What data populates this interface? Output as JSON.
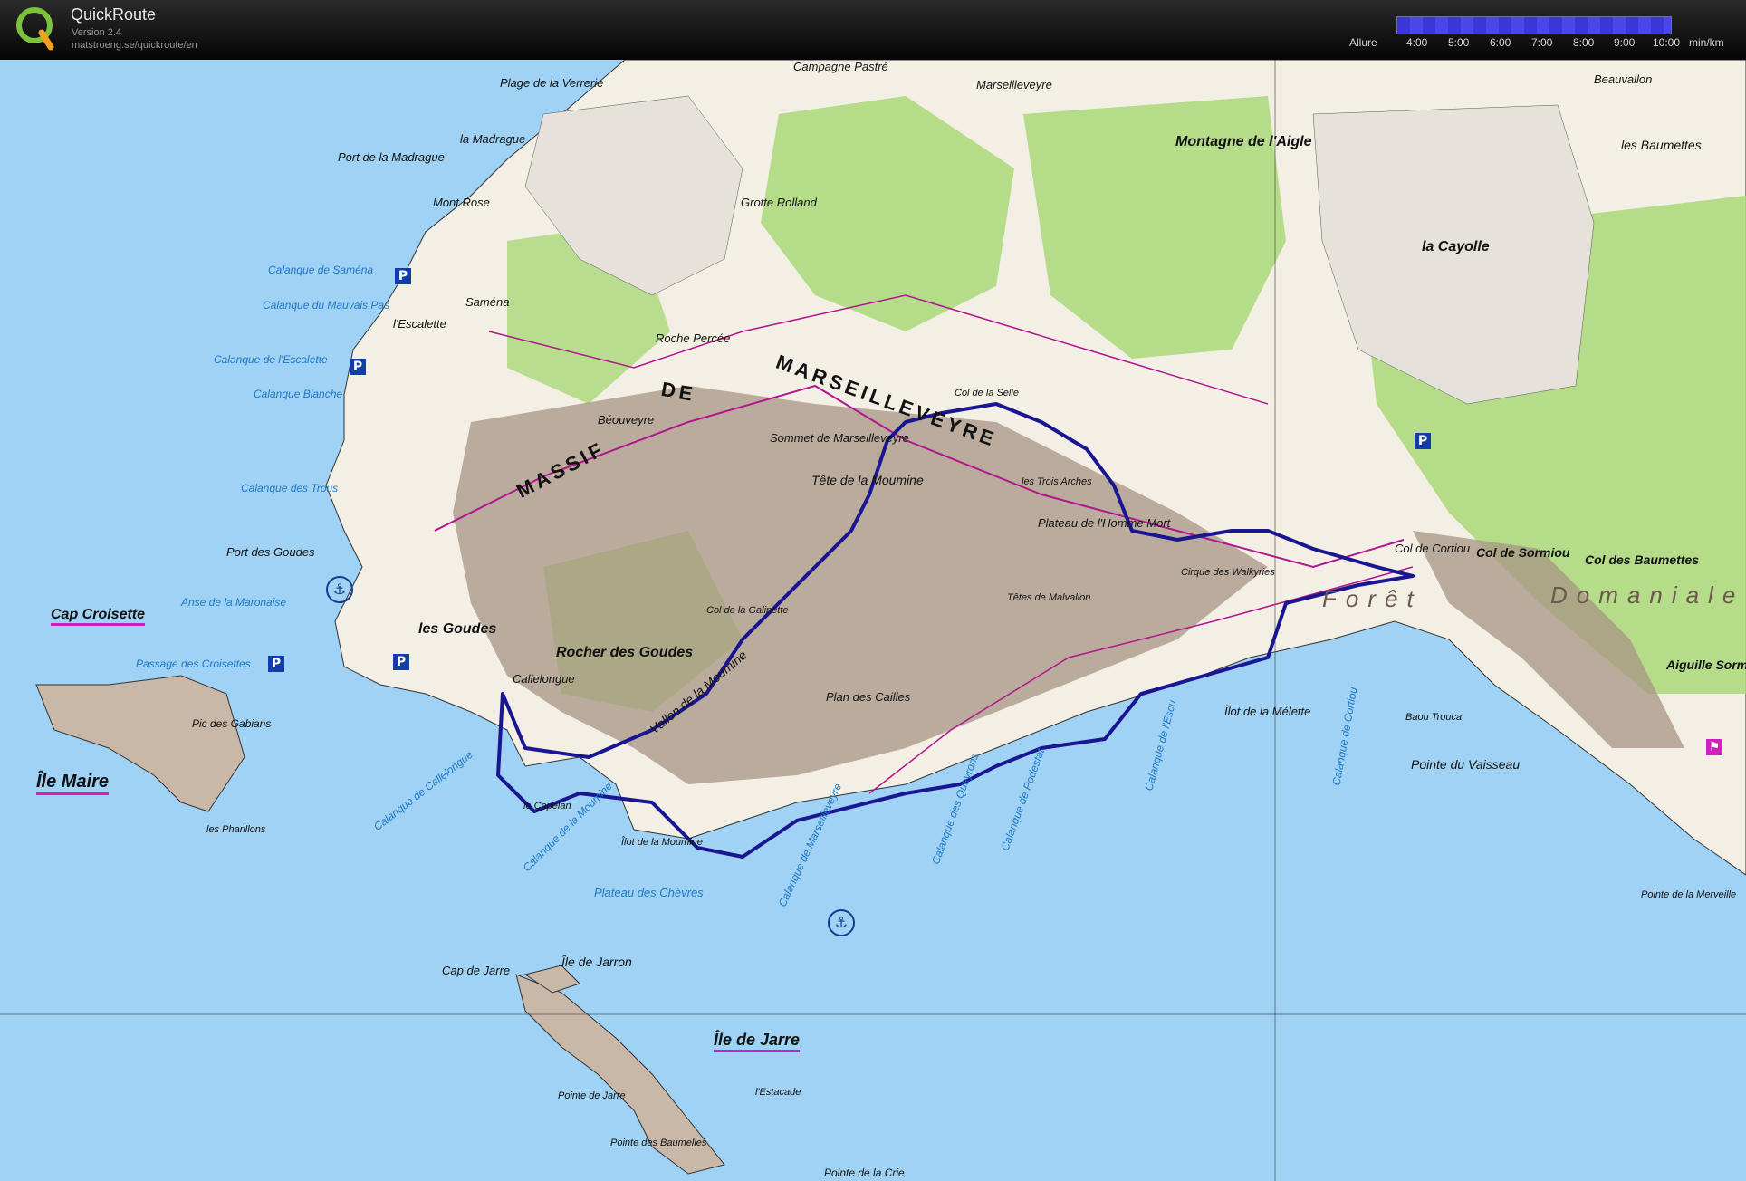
{
  "header": {
    "app_name": "QuickRoute",
    "version": "Version 2.4",
    "url": "matstroeng.se/quickroute/en",
    "pace_label": "Allure",
    "pace_ticks": [
      "4:00",
      "5:00",
      "6:00",
      "7:00",
      "8:00",
      "9:00",
      "10:00"
    ],
    "pace_unit": "min/km",
    "pace_color": "#3a36d8"
  },
  "map": {
    "sea_color": "#9fd2f4",
    "land_color": "#f3efe4",
    "forest_color": "#a9d878",
    "rock_color": "#a89484",
    "route_color": "#1a1591",
    "trail_color": "#b0168f",
    "labels": {
      "plage_verrerie": "Plage de la Verrerie",
      "madrague": "la Madrague",
      "port_madrague": "Port de la Madrague",
      "mont_rose": "Mont Rose",
      "calanque_samena": "Calanque de Saména",
      "calanque_mauvais_pas": "Calanque du Mauvais Pas",
      "samena": "Saména",
      "escalette": "l'Escalette",
      "calanque_escalette": "Calanque de l'Escalette",
      "calanque_blanche": "Calanque Blanche",
      "calanque_trous": "Calanque des Trous",
      "port_goudes": "Port des Goudes",
      "cap_croisette": "Cap Croisette",
      "anse_maronaise": "Anse de la Maronaise",
      "les_goudes": "les Goudes",
      "passage_croisettes": "Passage des Croisettes",
      "ile_maire": "Île Maire",
      "pic_gabians": "Pic des Gabians",
      "pharillons": "les Pharillons",
      "callelongue": "Callelongue",
      "calanque_callelongue": "Calanque de Callelongue",
      "rocher_goudes": "Rocher des Goudes",
      "massif": "MASSIF",
      "de": "DE",
      "marseilleveyre": "MARSEILLEVEYRE",
      "bequveyre": "Béouveyre",
      "roche_percee": "Roche Percée",
      "grotte_rolland": "Grotte Rolland",
      "campagne_pastre": "Campagne Pastré",
      "marseilleveyre_town": "Marseilleveyre",
      "montagne_aigle": "Montagne de l'Aigle",
      "sommet": "Sommet de Marseilleveyre",
      "tete_moumine": "Tête de la Moumine",
      "plateau_homme_mort": "Plateau de l'Homme Mort",
      "trois_arches": "les Trois Arches",
      "cirque_walkyries": "Cirque des Walkyries",
      "tetes_malvallon": "Têtes de Malvallon",
      "plan_cailles": "Plan des Cailles",
      "vallon_moumine": "Vallon de la Moumine",
      "calanque_moumine": "Calanque de la Moumine",
      "calanque_marseilleveyre": "Calanque de Marseilleveyre",
      "calanque_queyrons": "Calanque des Queyrons",
      "calanque_podestat": "Calanque de Podestat",
      "calanque_escu": "Calanque de l'Escu",
      "calanque_cortiou": "Calanque de Cortiou",
      "ilot_melette": "Îlot de la Mélette",
      "baou_trouca": "Baou Trouca",
      "pointe_vaisseau": "Pointe du Vaisseau",
      "col_cortiou": "Col de Cortiou",
      "col_sormiou": "Col de Sormiou",
      "col_baumettes": "Col des Baumettes",
      "foret": "Forêt",
      "domaniale": "Domaniale",
      "aiguille_sormiou": "Aiguille Sormiou",
      "pointe_merveille": "Pointe de la Merveille",
      "cayolle": "la Cayolle",
      "beauvallon": "Beauvallon",
      "baumettes": "les Baumettes",
      "plateau_chevres": "Plateau des Chèvres",
      "ilot_moumine": "Îlot de la Moumine",
      "le_capelan": "le Capelan",
      "ile_jarron": "Île de Jarron",
      "cap_jarre": "Cap de Jarre",
      "ile_jarre": "Île de Jarre",
      "pointe_jarre": "Pointe de Jarre",
      "estacade": "l'Estacade",
      "pointe_baumelles": "Pointe des Baumelles",
      "pointe_crie": "Pointe de la Crie",
      "col_galinette": "Col de la Galinette",
      "col_selle": "Col de la Selle"
    }
  }
}
